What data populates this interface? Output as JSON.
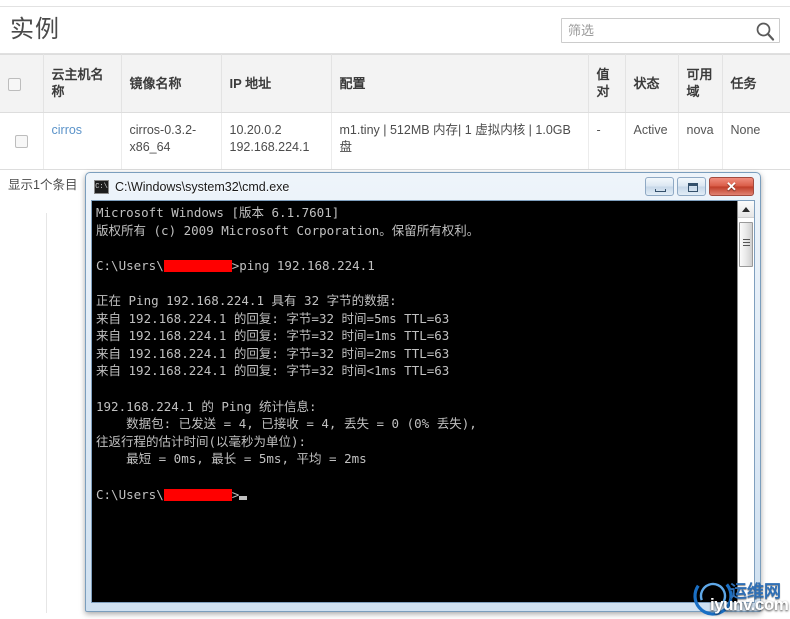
{
  "page": {
    "title": "实例"
  },
  "search": {
    "placeholder": "筛选",
    "value": "",
    "icon": "search-icon"
  },
  "table": {
    "headers": [
      "",
      "云主机名称",
      "镜像名称",
      "IP 地址",
      "配置",
      "值对",
      "状态",
      "可用域",
      "任务"
    ],
    "rows": [
      {
        "name": "cirros",
        "image": "cirros-0.3.2-x86_64",
        "ip": "10.20.0.2\n192.168.224.1",
        "flavor": "m1.tiny | 512MB 内存| 1 虚拟内核 | 1.0GB 盘",
        "key_pair": "-",
        "status": "Active",
        "zone": "nova",
        "task": "None"
      }
    ],
    "footer": "显示1个条目"
  },
  "cmd_window": {
    "title": "C:\\Windows\\system32\\cmd.exe",
    "icon": "cmd-icon",
    "buttons": {
      "minimize": "minimize-icon",
      "maximize": "maximize-icon",
      "close": "✕"
    },
    "lines": [
      "Microsoft Windows [版本 6.1.7601]",
      "版权所有 (c) 2009 Microsoft Corporation。保留所有权利。",
      "",
      "__PROMPT__>ping 192.168.224.1",
      "",
      "正在 Ping 192.168.224.1 具有 32 字节的数据:",
      "来自 192.168.224.1 的回复: 字节=32 时间=5ms TTL=63",
      "来自 192.168.224.1 的回复: 字节=32 时间=1ms TTL=63",
      "来自 192.168.224.1 的回复: 字节=32 时间=2ms TTL=63",
      "来自 192.168.224.1 的回复: 字节=32 时间<1ms TTL=63",
      "",
      "192.168.224.1 的 Ping 统计信息:",
      "    数据包: 已发送 = 4, 已接收 = 4, 丢失 = 0 (0% 丢失),",
      "往返行程的估计时间(以毫秒为单位):",
      "    最短 = 0ms, 最长 = 5ms, 平均 = 2ms",
      "",
      "__PROMPT__>__CURSOR__"
    ],
    "prompt_prefix": "C:\\Users\\",
    "redacted": true
  },
  "watermark": {
    "text_top": "运维网",
    "text_bottom": "iyunv.com"
  },
  "colors": {
    "link": "#5b93c9",
    "header_bg": "#f3f3f3",
    "console_bg": "#000000",
    "console_fg": "#c0c0c0",
    "redaction": "#ff0000",
    "close_button": "#bf3c28"
  }
}
